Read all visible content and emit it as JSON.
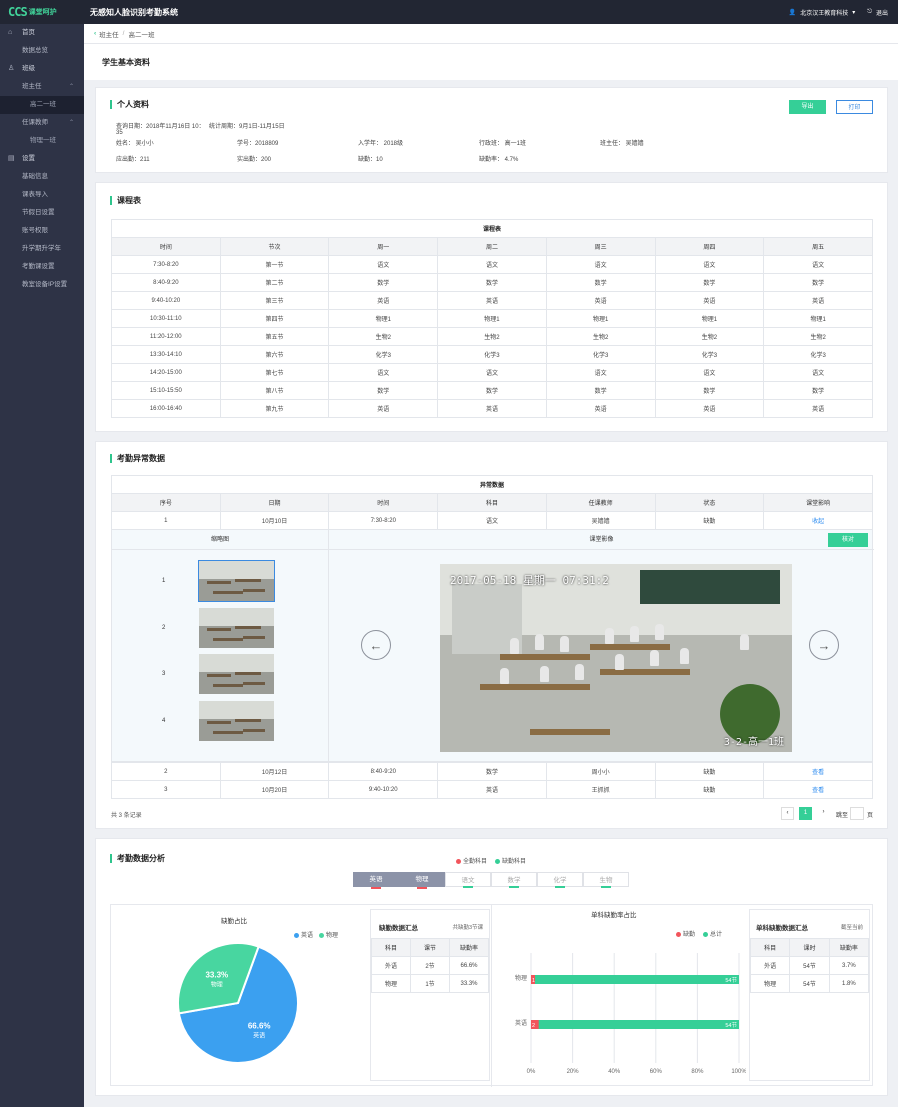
{
  "app": {
    "logo": "CCS",
    "logo_sub": "课堂呵护",
    "title": "无感知人脸识别考勤系统",
    "user": "北京汉王教育科技",
    "logout": "退出",
    "accent": "#35cf97"
  },
  "sidebar": {
    "items": [
      {
        "label": "首页",
        "icon": "home-icon",
        "type": "top"
      },
      {
        "label": "数据总览",
        "type": "lv2"
      },
      {
        "label": "班级",
        "icon": "users-icon",
        "type": "top"
      },
      {
        "label": "班主任",
        "type": "lv2",
        "chev": "^"
      },
      {
        "label": "高二一班",
        "type": "sub",
        "active": true
      },
      {
        "label": "任课教师",
        "type": "lv2",
        "chev": "^"
      },
      {
        "label": "物理一班",
        "type": "sub"
      },
      {
        "label": "设置",
        "icon": "settings-icon",
        "type": "top"
      },
      {
        "label": "基础信息",
        "type": "lv2"
      },
      {
        "label": "课表导入",
        "type": "lv2"
      },
      {
        "label": "节假日设置",
        "type": "lv2"
      },
      {
        "label": "账号权限",
        "type": "lv2"
      },
      {
        "label": "升学期升学年",
        "type": "lv2"
      },
      {
        "label": "考勤课设置",
        "type": "lv2"
      },
      {
        "label": "教室设备IP设置",
        "type": "lv2"
      }
    ]
  },
  "breadcrumb": {
    "parent": "班主任",
    "current": "高二一班"
  },
  "page_title": "学生基本资料",
  "profile": {
    "title": "个人资料",
    "export": "导出",
    "print": "打印",
    "query_date": "查询日期：2018年11月16日 10：35",
    "stat_period": "统计周期：9月1日-11月15日",
    "name": "姓名： 吴小小",
    "student_no": "学号：2018809",
    "enroll_year": "入学年： 2018级",
    "admin_class": "行政班： 高一1班",
    "head_teacher": "班主任： 吴嫱嫱",
    "should_attend": "应出勤：211",
    "actual_attend": "实出勤：200",
    "absence": "缺勤：10",
    "absence_rate": "缺勤率： 4.7%"
  },
  "schedule": {
    "title": "课程表",
    "caption": "课程表",
    "headers": [
      "时间",
      "节次",
      "周一",
      "周二",
      "周三",
      "周四",
      "周五"
    ],
    "rows": [
      [
        "7:30-8:20",
        "第一节",
        "语文",
        "语文",
        "语文",
        "语文",
        "语文"
      ],
      [
        "8:40-9:20",
        "第二节",
        "数学",
        "数学",
        "数学",
        "数学",
        "数学"
      ],
      [
        "9:40-10:20",
        "第三节",
        "英语",
        "英语",
        "英语",
        "英语",
        "英语"
      ],
      [
        "10:30-11:10",
        "第四节",
        "物理1",
        "物理1",
        "物理1",
        "物理1",
        "物理1"
      ],
      [
        "11:20-12:00",
        "第五节",
        "生物2",
        "生物2",
        "生物2",
        "生物2",
        "生物2"
      ],
      [
        "13:30-14:10",
        "第六节",
        "化学3",
        "化学3",
        "化学3",
        "化学3",
        "化学3"
      ],
      [
        "14:20-15:00",
        "第七节",
        "语文",
        "语文",
        "语文",
        "语文",
        "语文"
      ],
      [
        "15:10-15:50",
        "第八节",
        "数学",
        "数学",
        "数学",
        "数学",
        "数学"
      ],
      [
        "16:00-16:40",
        "第九节",
        "英语",
        "英语",
        "英语",
        "英语",
        "英语"
      ]
    ]
  },
  "anomaly": {
    "title": "考勤异常数据",
    "caption": "异常数据",
    "headers": [
      "序号",
      "日期",
      "时间",
      "科目",
      "任课教师",
      "状态",
      "课堂影响"
    ],
    "rows": [
      [
        "1",
        "10月10日",
        "7:30-8:20",
        "语文",
        "吴嫱嫱",
        "缺勤",
        "收起"
      ],
      [
        "2",
        "10月12日",
        "8:40-9:20",
        "数学",
        "周小小",
        "缺勤",
        "查看"
      ],
      [
        "3",
        "10月20日",
        "9:40-10:20",
        "英语",
        "王抓抓",
        "缺勤",
        "查看"
      ]
    ],
    "thumb_header": "缩略图",
    "video_header": "课堂影像",
    "verify": "核对",
    "thumbs": [
      "1",
      "2",
      "3",
      "4"
    ],
    "video_timestamp": "2017-05-18 星期一 07:31:2",
    "video_room": "3-2-高一1班",
    "total": "共 3 条记录",
    "page": "1",
    "goto": "跳至",
    "page_unit": "页"
  },
  "analysis": {
    "title": "考勤数据分析",
    "legend": [
      {
        "label": "全勤科目",
        "color": "#f2545b"
      },
      {
        "label": "缺勤科目",
        "color": "#35cf97"
      }
    ],
    "tabs": [
      {
        "label": "英语",
        "selected": true,
        "mark": "#f2545b"
      },
      {
        "label": "物理",
        "selected": true,
        "mark": "#f2545b"
      },
      {
        "label": "语文",
        "selected": false,
        "mark": "#35cf97"
      },
      {
        "label": "数学",
        "selected": false,
        "mark": "#35cf97"
      },
      {
        "label": "化学",
        "selected": false,
        "mark": "#35cf97"
      },
      {
        "label": "生物",
        "selected": false,
        "mark": "#35cf97"
      }
    ],
    "pie_title": "缺勤占比",
    "summary": {
      "title": "缺勤数据汇总",
      "note": "共缺勤3节课",
      "headers": [
        "科目",
        "课节",
        "缺勤率"
      ],
      "rows": [
        [
          "外语",
          "2节",
          "66.6%"
        ],
        [
          "物理",
          "1节",
          "33.3%"
        ]
      ]
    },
    "bar_title": "单科缺勤率占比",
    "bar_legend": [
      {
        "label": "缺勤",
        "color": "#f2545b"
      },
      {
        "label": "总计",
        "color": "#35cf97"
      }
    ],
    "single": {
      "title": "单科缺勤数据汇总",
      "note": "截至当前",
      "headers": [
        "科目",
        "课时",
        "缺勤率"
      ],
      "rows": [
        [
          "外语",
          "54节",
          "3.7%"
        ],
        [
          "物理",
          "54节",
          "1.8%"
        ]
      ]
    }
  },
  "chart_data": [
    {
      "type": "pie",
      "title": "缺勤占比",
      "legend": [
        "英语",
        "物理"
      ],
      "slices": [
        {
          "name": "英语",
          "value": 66.6,
          "label": "66.6%",
          "color": "#3ba0f0"
        },
        {
          "name": "物理",
          "value": 33.3,
          "label": "33.3%",
          "color": "#48d6a0"
        }
      ]
    },
    {
      "type": "bar",
      "title": "单科缺勤率占比",
      "orientation": "horizontal",
      "categories": [
        "物理",
        "英语"
      ],
      "series": [
        {
          "name": "缺勤",
          "values": [
            1,
            2
          ],
          "color": "#f2545b"
        },
        {
          "name": "总计",
          "values": [
            54,
            54
          ],
          "color": "#35cf97"
        }
      ],
      "xticks": [
        "0%",
        "20%",
        "40%",
        "60%",
        "80%",
        "100%"
      ]
    }
  ]
}
